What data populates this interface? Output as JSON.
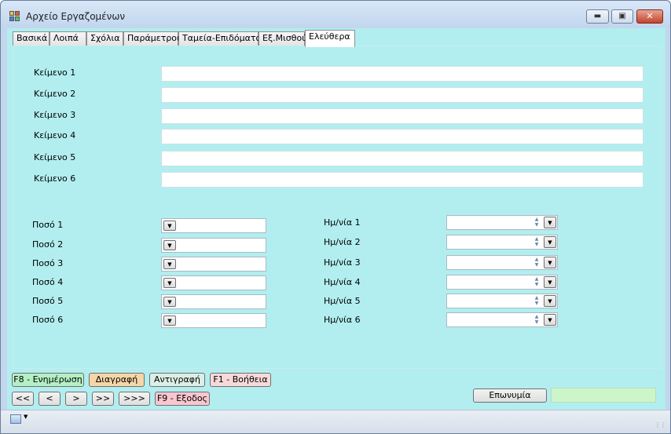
{
  "window": {
    "title": "Αρχείο Εργαζομένων"
  },
  "tabs": [
    {
      "label": "Βασικά"
    },
    {
      "label": "Λοιπά"
    },
    {
      "label": "Σχόλια"
    },
    {
      "label": "Παράμετροι"
    },
    {
      "label": "Ταμεία-Επιδόματα"
    },
    {
      "label": "Εξ.Μισθού"
    },
    {
      "label": "Ελεύθερα",
      "active": true
    }
  ],
  "text_fields": [
    {
      "label": "Κείμενο 1",
      "value": ""
    },
    {
      "label": "Κείμενο 2",
      "value": ""
    },
    {
      "label": "Κείμενο 3",
      "value": ""
    },
    {
      "label": "Κείμενο 4",
      "value": ""
    },
    {
      "label": "Κείμενο 5",
      "value": ""
    },
    {
      "label": "Κείμενο 6",
      "value": ""
    }
  ],
  "amount_fields": [
    {
      "label": "Ποσό 1",
      "value": ""
    },
    {
      "label": "Ποσό 2",
      "value": ""
    },
    {
      "label": "Ποσό 3",
      "value": ""
    },
    {
      "label": "Ποσό 4",
      "value": ""
    },
    {
      "label": "Ποσό 5",
      "value": ""
    },
    {
      "label": "Ποσό 6",
      "value": ""
    }
  ],
  "date_fields": [
    {
      "label": "Ημ/νία 1",
      "value": ""
    },
    {
      "label": "Ημ/νία 2",
      "value": ""
    },
    {
      "label": "Ημ/νία 3",
      "value": ""
    },
    {
      "label": "Ημ/νία 4",
      "value": ""
    },
    {
      "label": "Ημ/νία 5",
      "value": ""
    },
    {
      "label": "Ημ/νία 6",
      "value": ""
    }
  ],
  "action_buttons": {
    "update": {
      "label": "F8 - Ενημέρωση",
      "color": "#b5f0c5"
    },
    "delete": {
      "label": "Διαγραφή",
      "color": "#f5d6a8"
    },
    "copy": {
      "label": "Αντιγραφή",
      "color": "#dcefe6"
    },
    "help": {
      "label": "F1 - Βοήθεια",
      "color": "#f7d9d9"
    }
  },
  "nav_buttons": {
    "first": "<<",
    "prev": "<",
    "next": ">",
    "next_page": ">>",
    "last": ">>>",
    "exit": {
      "label": "F9 - Εξοδος",
      "color": "#f7c6cf"
    }
  },
  "surname": {
    "button_label": "Επωνυμία",
    "value": "",
    "field_color": "#ccf5c9"
  }
}
